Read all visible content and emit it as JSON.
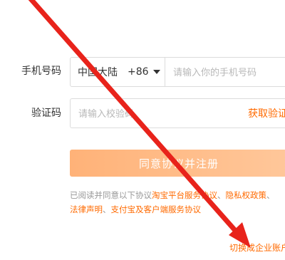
{
  "form": {
    "phone_label": "手机号码",
    "region_name": "中国大陆",
    "region_code": "+86",
    "phone_placeholder": "请输入你的手机号码",
    "code_label": "验证码",
    "code_placeholder": "请输入校验码",
    "get_code_label": "获取验证码",
    "submit_label": "同意协议并注册"
  },
  "agreement": {
    "prefix": "已阅读并同意以下协议",
    "link1": "淘宝平台服务协议",
    "sep1": "、",
    "link2": "隐私权政策",
    "sep2": "、",
    "link3": "法律声明",
    "sep3": "、",
    "link4": "支付宝及客户端服务协议"
  },
  "footer": {
    "switch_label": "切换成企业账户注册"
  },
  "colors": {
    "accent": "#ff6a00",
    "annotation_arrow": "#e8231b"
  }
}
